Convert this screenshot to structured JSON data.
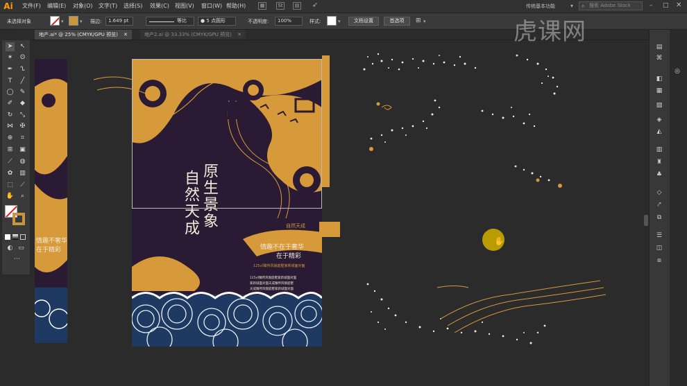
{
  "app": {
    "logo": "Ai"
  },
  "menu": [
    "文件(F)",
    "编辑(E)",
    "对象(O)",
    "文字(T)",
    "选择(S)",
    "效果(C)",
    "视图(V)",
    "窗口(W)",
    "帮助(H)"
  ],
  "workspace": "传统基本功能",
  "search": {
    "placeholder": "搜索 Adobe Stock"
  },
  "control": {
    "selection_status": "未选择对象",
    "stroke_label": "描边:",
    "stroke_value": "1.649",
    "stroke_unit": "pt",
    "line_style": "等比",
    "brush": "5 点圆形",
    "opacity_label": "不透明度:",
    "opacity_value": "100%",
    "style_label": "样式:",
    "doc_setup": "文档设置",
    "preferences": "首选项"
  },
  "tabs": [
    {
      "label": "地产.ai* @ 25% (CMYK/GPU 预览)",
      "active": true
    },
    {
      "label": "地产2.ai @ 33.33% (CMYK/GPU 预览)",
      "active": false
    }
  ],
  "poster": {
    "title_col1": "原生景象",
    "title_col2": "自然天成",
    "subtitle_line1": "情趣不在于奢华",
    "subtitle_line2": "在于精彩",
    "brand": "自然天成",
    "orange_line": "125㎡臻传风貌庭墅家新城面对面",
    "white_line1": "125㎡臻传风貌庭墅家新城面对面",
    "white_line2": "家新城面对面天成臻传风貌庭墅",
    "white_line3": "天成臻传风貌庭墅家新城面对面"
  },
  "poster2": {
    "line1": "情趣不奢华",
    "line2": "在于精彩"
  },
  "watermark": "虎课网",
  "colors": {
    "gold": "#d69a3a",
    "purple": "#2a1a33",
    "navy": "#1e3a63"
  },
  "icons": [
    "search-icon",
    "selection-tool-icon",
    "direct-selection-icon",
    "pen-icon",
    "type-icon",
    "hand-icon",
    "zoom-icon",
    "layers-icon",
    "swatches-icon"
  ]
}
